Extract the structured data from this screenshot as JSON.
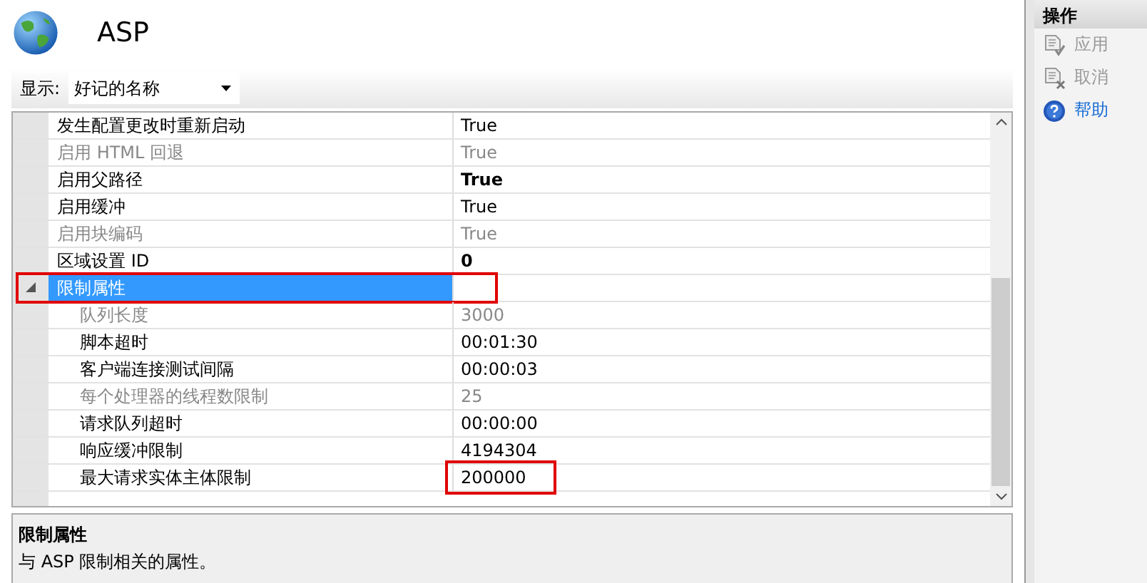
{
  "header": {
    "title": "ASP"
  },
  "toolbar": {
    "label": "显示:",
    "dropdown": {
      "value": "好记的名称"
    }
  },
  "properties": [
    {
      "kind": "property",
      "name": "发生配置更改时重新启动",
      "value": "True",
      "disabled": false,
      "bold": false
    },
    {
      "kind": "property",
      "name": "启用 HTML 回退",
      "value": "True",
      "disabled": true,
      "bold": false
    },
    {
      "kind": "property",
      "name": "启用父路径",
      "value": "True",
      "disabled": false,
      "bold": true
    },
    {
      "kind": "property",
      "name": "启用缓冲",
      "value": "True",
      "disabled": false,
      "bold": false
    },
    {
      "kind": "property",
      "name": "启用块编码",
      "value": "True",
      "disabled": true,
      "bold": false
    },
    {
      "kind": "property",
      "name": "区域设置 ID",
      "value": "0",
      "disabled": false,
      "bold": true
    },
    {
      "kind": "category",
      "name": "限制属性",
      "expanded": true,
      "selected": true,
      "highlighted": true,
      "children": [
        {
          "kind": "property",
          "name": "队列长度",
          "value": "3000",
          "disabled": true,
          "bold": false,
          "highlighted": false
        },
        {
          "kind": "property",
          "name": "脚本超时",
          "value": "00:01:30",
          "disabled": false,
          "bold": false,
          "highlighted": false
        },
        {
          "kind": "property",
          "name": "客户端连接测试间隔",
          "value": "00:00:03",
          "disabled": false,
          "bold": false,
          "highlighted": false
        },
        {
          "kind": "property",
          "name": "每个处理器的线程数限制",
          "value": "25",
          "disabled": true,
          "bold": false,
          "highlighted": false
        },
        {
          "kind": "property",
          "name": "请求队列超时",
          "value": "00:00:00",
          "disabled": false,
          "bold": false,
          "highlighted": false
        },
        {
          "kind": "property",
          "name": "响应缓冲限制",
          "value": "4194304",
          "disabled": false,
          "bold": false,
          "highlighted": false
        },
        {
          "kind": "property",
          "name": "最大请求实体主体限制",
          "value": "200000",
          "disabled": false,
          "bold": false,
          "highlighted": true
        }
      ]
    }
  ],
  "description": {
    "title": "限制属性",
    "text": "与 ASP 限制相关的属性。"
  },
  "actions": {
    "title": "操作",
    "items": [
      {
        "kind": "apply",
        "label": "应用",
        "disabled": true
      },
      {
        "kind": "cancel",
        "label": "取消",
        "disabled": true
      },
      {
        "kind": "help",
        "label": "帮助",
        "disabled": false
      }
    ]
  }
}
